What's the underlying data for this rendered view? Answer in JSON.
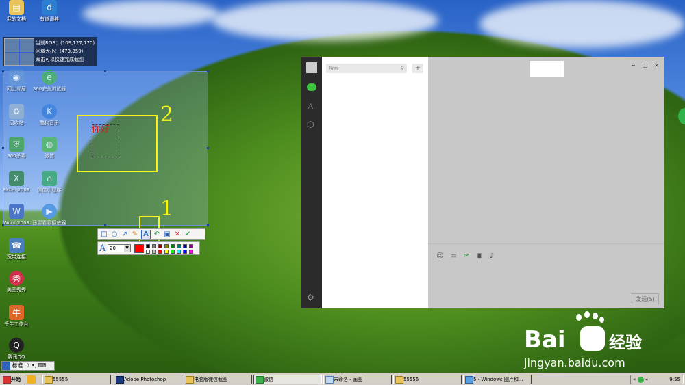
{
  "desktop_icons": [
    {
      "label": "我的文档",
      "icon": "folder-icon"
    },
    {
      "label": "有道词典",
      "icon": "dictionary-icon"
    },
    {
      "label": "网上邻居",
      "icon": "network-icon"
    },
    {
      "label": "360安全浏览器",
      "icon": "browser-icon"
    },
    {
      "label": "回收站",
      "icon": "recycle-bin-icon"
    },
    {
      "label": "酷狗音乐",
      "icon": "music-icon"
    },
    {
      "label": "360杀毒",
      "icon": "shield-icon"
    },
    {
      "label": "微信",
      "icon": "wechat-icon"
    },
    {
      "label": "Excel 2003",
      "icon": "excel-icon"
    },
    {
      "label": "微信小程序",
      "icon": "mini-program-icon"
    },
    {
      "label": "Word 2003",
      "icon": "word-icon"
    },
    {
      "label": "迅雷看看播放器",
      "icon": "player-icon"
    },
    {
      "label": "宽带连接",
      "icon": "broadband-icon"
    },
    {
      "label": "美图秀秀",
      "icon": "meitu-icon"
    },
    {
      "label": "千牛工作台",
      "icon": "qianniu-icon"
    },
    {
      "label": "腾讯QQ",
      "icon": "qq-icon"
    }
  ],
  "screenshot_info": {
    "rgb_line": "当前RGB：(109,127,170)",
    "size_line": "区域大小：(473,359)",
    "hint_line": "双击可以快速完成截图"
  },
  "annotations": {
    "number_1": "1",
    "number_2": "2",
    "text_sample": "你好"
  },
  "screenshot_toolbar": {
    "tools": [
      {
        "name": "rectangle-icon",
        "glyph": "□"
      },
      {
        "name": "ellipse-icon",
        "glyph": "○"
      },
      {
        "name": "arrow-icon",
        "glyph": "↗"
      },
      {
        "name": "brush-icon",
        "glyph": "✎"
      },
      {
        "name": "text-tool-icon",
        "glyph": "A"
      },
      {
        "name": "undo-icon",
        "glyph": "↶"
      },
      {
        "name": "save-icon",
        "glyph": "▣"
      },
      {
        "name": "cancel-icon",
        "glyph": "✕"
      },
      {
        "name": "confirm-icon",
        "glyph": "✔"
      }
    ],
    "font_glyph": "A",
    "font_size": "20",
    "selected_color": "#ff0000",
    "palette": [
      "#000000",
      "#808080",
      "#800000",
      "#808000",
      "#008000",
      "#008080",
      "#000080",
      "#800080",
      "#ffffff",
      "#c0c0c0",
      "#ff0000",
      "#ffff00",
      "#00ff00",
      "#00ffff",
      "#0000ff",
      "#ff00ff"
    ]
  },
  "wechat": {
    "search_placeholder": "搜索",
    "add_button": "+",
    "send_button": "发送(S)",
    "window_controls": [
      "−",
      "□",
      "×"
    ]
  },
  "taskbar": {
    "start_label": "开始",
    "ime": {
      "mode": "标准"
    },
    "tasks": [
      {
        "label": "55555"
      },
      {
        "label": "Adobe Photoshop"
      },
      {
        "label": "电脑版微信截图"
      },
      {
        "label": "微信"
      },
      {
        "label": "未命名 - 画图"
      },
      {
        "label": "55555"
      },
      {
        "label": "5 - Windows 图片和..."
      }
    ],
    "clock": "9:55"
  },
  "watermark": {
    "brand": "Bai",
    "brand_cn": "经验",
    "url": "jingyan.baidu.com"
  }
}
